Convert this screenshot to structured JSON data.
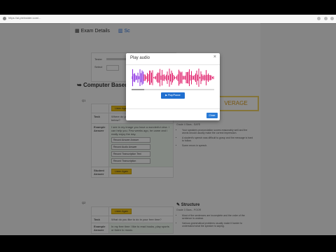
{
  "browser": {
    "url": "https://ai.pteinsider.com/..."
  },
  "header": {
    "exam_details": "Exam Details",
    "scores_tab": "Sc"
  },
  "info": {
    "row1_label": "Tester",
    "row2_label": "Select"
  },
  "main": {
    "section_title": "Computer Based Sc",
    "q1_label": "Q1",
    "q2_label": "Q2",
    "overall_badge": "VERAGE"
  },
  "task1": {
    "header_btn": "Listen Again",
    "rows": [
      {
        "label": "Task",
        "text": "Where do you think we would find the words below?"
      },
      {
        "label": "Example Answer",
        "text": "I see in my image you have a wonderful view. I can help you. Few weeks ago, he came and I really enjoy the day."
      },
      {
        "label": "Student Answer",
        "text": ""
      }
    ],
    "options": [
      "Record Answer Answer",
      "Record Audio Answer",
      "Record Transcription Text",
      "Record Transcription"
    ],
    "student_btn": "Listen Again"
  },
  "task2": {
    "header_btn": "Listen Again",
    "rows": [
      {
        "label": "Task",
        "text": "What do you like to do in your free time?"
      },
      {
        "label": "Example Answer",
        "text": "In my free time I like to read books, play sports or listen to music."
      }
    ]
  },
  "rubric_pron": {
    "title": "Pronunciation",
    "score": "Grade 4 Stars - SAFE",
    "items": [
      "Your speakers pronunciation scores reasonably well and the words should usually make the correct impression.",
      "A student's speech was difficult to grasp and the message is hard to follow.",
      "Some errors in speech."
    ]
  },
  "rubric_struct": {
    "title": "Structure",
    "score": "Grade 3 Stars - POOR",
    "items": [
      "Most of the sentences are incomplete and the order of the sentence is unclear.",
      "Various grammatical problems usually make it harder to understand what the speaker is saying."
    ]
  },
  "modal": {
    "title": "Play audio",
    "close_symbol": "×",
    "play_label": "Play/Pause",
    "close_label": "Close",
    "progress_fraction": 0.15
  }
}
